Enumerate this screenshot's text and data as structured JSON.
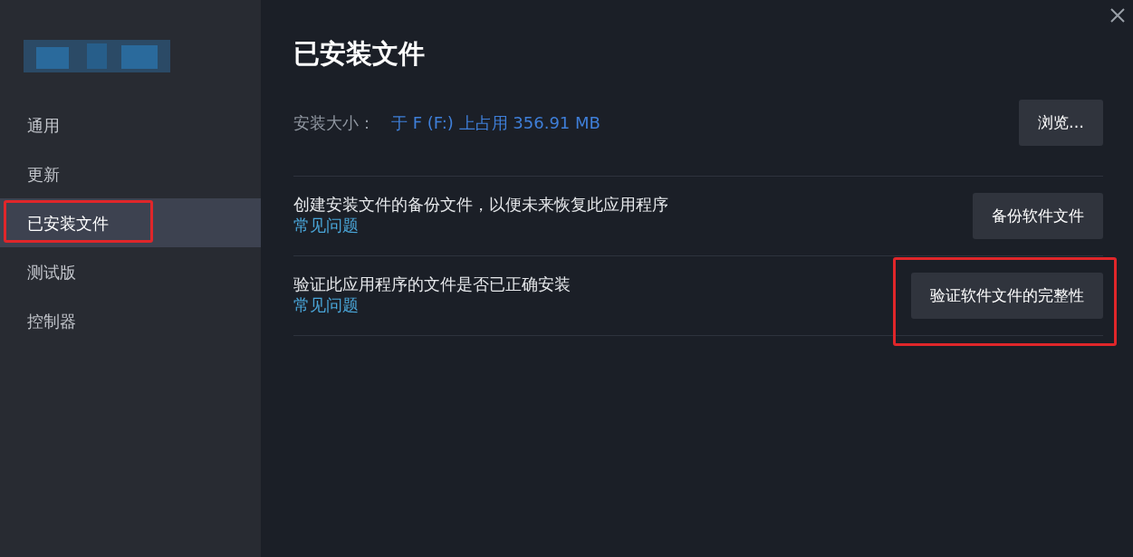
{
  "sidebar": {
    "items": [
      {
        "label": "通用",
        "selected": false,
        "highlighted": false
      },
      {
        "label": "更新",
        "selected": false,
        "highlighted": false
      },
      {
        "label": "已安装文件",
        "selected": true,
        "highlighted": true
      },
      {
        "label": "测试版",
        "selected": false,
        "highlighted": false
      },
      {
        "label": "控制器",
        "selected": false,
        "highlighted": false
      }
    ]
  },
  "page_title": "已安装文件",
  "install_size": {
    "label": "安装大小：",
    "value": "于 F (F:) 上占用 356.91 MB",
    "button": "浏览…"
  },
  "actions": [
    {
      "description": "创建安装文件的备份文件，以便未来恢复此应用程序",
      "link": "常见问题",
      "button": "备份软件文件",
      "highlighted": false
    },
    {
      "description": "验证此应用程序的文件是否已正确安装",
      "link": "常见问题",
      "button": "验证软件文件的完整性",
      "highlighted": true
    }
  ]
}
